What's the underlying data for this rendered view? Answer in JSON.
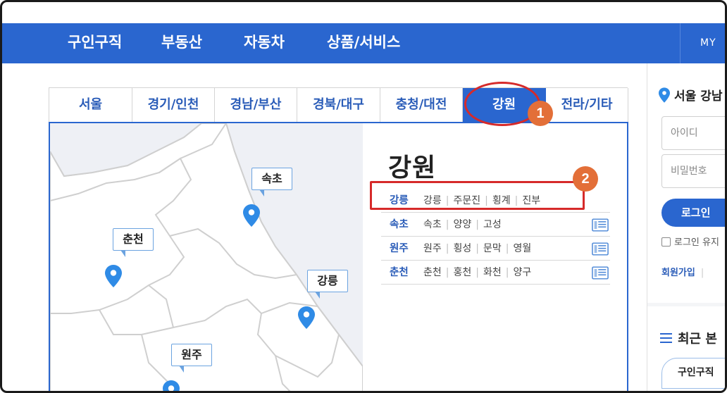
{
  "nav": {
    "items": [
      "구인구직",
      "부동산",
      "자동차",
      "상품/서비스"
    ],
    "my_label": "MY"
  },
  "regions": {
    "tabs": [
      "서울",
      "경기/인천",
      "경남/부산",
      "경북/대구",
      "충청/대전",
      "강원",
      "전라/기타"
    ],
    "active": "강원"
  },
  "map": {
    "labels": [
      "속초",
      "춘천",
      "강릉",
      "원주"
    ]
  },
  "detail": {
    "title": "강원",
    "rows": [
      {
        "city": "강릉",
        "subs": [
          "강릉",
          "주문진",
          "횡계",
          "진부"
        ]
      },
      {
        "city": "속초",
        "subs": [
          "속초",
          "양양",
          "고성"
        ]
      },
      {
        "city": "원주",
        "subs": [
          "원주",
          "횡성",
          "문막",
          "영월"
        ]
      },
      {
        "city": "춘천",
        "subs": [
          "춘천",
          "홍천",
          "화천",
          "양구"
        ]
      }
    ]
  },
  "annotations": {
    "badge1": "1",
    "badge2": "2"
  },
  "sidebar": {
    "location": "서울 강남",
    "id_placeholder": "아이디",
    "pw_placeholder": "비밀번호",
    "login_button": "로그인",
    "keep_login": "로그인 유지",
    "join_link": "회원가입",
    "recent_title": "최근 본",
    "recent_tab": "구인구직"
  },
  "colors": {
    "primary": "#2a66cf",
    "annotation_red": "#d62a2a",
    "badge_orange": "#e36f38"
  }
}
